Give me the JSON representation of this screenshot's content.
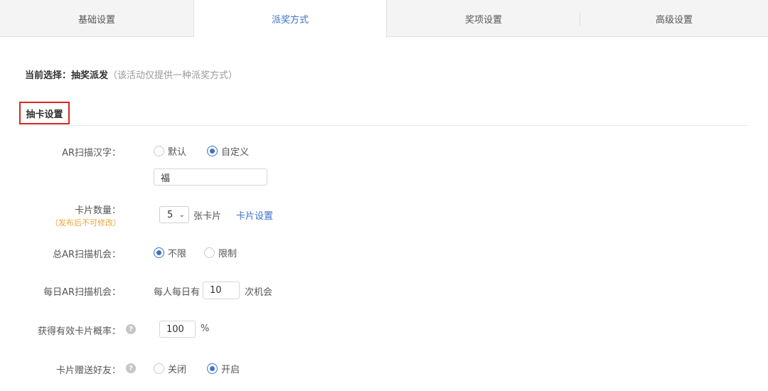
{
  "tabs": [
    {
      "label": "基础设置",
      "active": false
    },
    {
      "label": "派奖方式",
      "active": true
    },
    {
      "label": "奖项设置",
      "active": false
    },
    {
      "label": "高级设置",
      "active": false
    }
  ],
  "current": {
    "prefix": "当前选择：",
    "value": "抽奖派发",
    "hint": "（该活动仅提供一种派奖方式）"
  },
  "section": {
    "title": "抽卡设置"
  },
  "ar_char": {
    "label": "AR扫描汉字：",
    "options": [
      {
        "label": "默认",
        "selected": false
      },
      {
        "label": "自定义",
        "selected": true
      }
    ],
    "value": "福"
  },
  "card_count": {
    "label": "卡片数量：",
    "note": "（发布后不可修改）",
    "selected": "5",
    "unit": "张卡片",
    "link": "卡片设置"
  },
  "total_chances": {
    "label": "总AR扫描机会：",
    "options": [
      {
        "label": "不限",
        "selected": true
      },
      {
        "label": "限制",
        "selected": false
      }
    ]
  },
  "daily_chances": {
    "label": "每日AR扫描机会：",
    "prefix": "每人每日有",
    "value": "10",
    "suffix": "次机会"
  },
  "probability": {
    "label": "获得有效卡片概率：",
    "help": "?",
    "value": "100",
    "unit": "%"
  },
  "gift_friends": {
    "label": "卡片赠送好友：",
    "help": "?",
    "options": [
      {
        "label": "关闭",
        "selected": false
      },
      {
        "label": "开启",
        "selected": true
      }
    ]
  },
  "colors": {
    "accent": "#3b73c4",
    "highlight_border": "#d9281f",
    "note": "#f0a23a"
  }
}
